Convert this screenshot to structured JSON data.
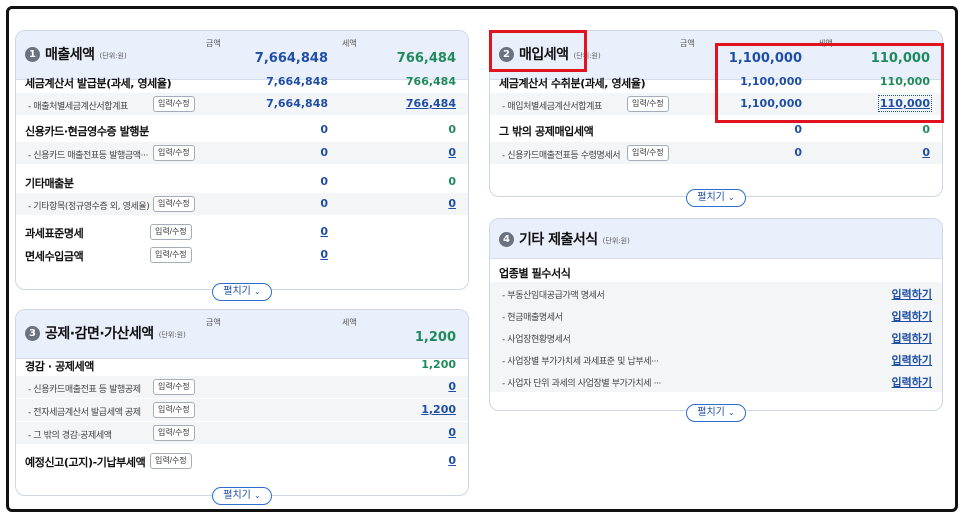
{
  "sales": {
    "badge": "1",
    "title": "매출세액",
    "unit": "(단위:원)",
    "col_amount": "금액",
    "col_tax": "세액",
    "total_amount": "7,664,848",
    "total_tax": "766,484",
    "rows": [
      {
        "label": "세금계산서 발급분(과세, 영세율)",
        "amount": "7,664,848",
        "tax": "766,484"
      },
      {
        "label": "- 매출처별세금계산서합계표",
        "button": "입력/수정",
        "amount": "7,664,848",
        "tax": "766,484"
      },
      {
        "label": "신용카드·현금영수증 발행분",
        "amount": "0",
        "tax": "0"
      },
      {
        "label": "- 신용카드 매출전표등 발행금액···",
        "button": "입력/수정",
        "amount": "0",
        "tax": "0"
      },
      {
        "label": "기타매출분",
        "amount": "0",
        "tax": "0"
      },
      {
        "label": "- 기타항목(정규영수증 외, 영세율)",
        "button": "입력/수정",
        "amount": "0",
        "tax": "0"
      },
      {
        "label": "과세표준명세",
        "button": "입력/수정",
        "amount": "0"
      },
      {
        "label": "면세수입금액",
        "button": "입력/수정",
        "amount": "0"
      }
    ],
    "expand": "펼치기"
  },
  "purchase": {
    "badge": "2",
    "title": "매입세액",
    "unit": "(단위:원)",
    "col_amount": "금액",
    "col_tax": "세액",
    "total_amount": "1,100,000",
    "total_tax": "110,000",
    "rows": [
      {
        "label": "세금계산서 수취분(과세, 영세율)",
        "amount": "1,100,000",
        "tax": "110,000"
      },
      {
        "label": "- 매입처별세금계산서합계표",
        "button": "입력/수정",
        "amount": "1,100,000",
        "tax": "110,000"
      },
      {
        "label": "그 밖의 공제매입세액",
        "amount": "0",
        "tax": "0"
      },
      {
        "label": "- 신용카드매출전표등 수령명세서",
        "button": "입력/수정",
        "amount": "0",
        "tax": "0"
      }
    ],
    "expand": "펼치기"
  },
  "deduction": {
    "badge": "3",
    "title": "공제·감면·가산세액",
    "unit": "(단위:원)",
    "col_amount": "금액",
    "col_tax": "세액",
    "total_tax": "1,200",
    "rows": [
      {
        "label": "경감 · 공제세액",
        "tax": "1,200"
      },
      {
        "label": "- 신용카드매출전표 등 발행공제",
        "button": "입력/수정",
        "tax": "0"
      },
      {
        "label": "- 전자세금계산서 발급세액 공제",
        "button": "입력/수정",
        "tax": "1,200"
      },
      {
        "label": "- 그 밖의 경감·공제세액",
        "button": "입력/수정",
        "tax": "0"
      },
      {
        "label": "예정신고(고지)-기납부세액",
        "button": "입력/수정",
        "tax": "0"
      }
    ],
    "expand": "펼치기"
  },
  "other": {
    "badge": "4",
    "title": "기타 제출서식",
    "unit": "(단위:원)",
    "section_label": "업종별 필수서식",
    "rows": [
      {
        "label": "- 부동산임대공급가액 명세서",
        "action": "입력하기"
      },
      {
        "label": "- 현금매출명세서",
        "action": "입력하기"
      },
      {
        "label": "- 사업장현황명세서",
        "action": "입력하기"
      },
      {
        "label": "- 사업장별 부가가치세 과세표준 및 납부세···",
        "action": "입력하기"
      },
      {
        "label": "- 사업자 단위 과세의 사업장별 부가가치세 ···",
        "action": "입력하기"
      }
    ],
    "expand": "펼치기"
  },
  "colors": {
    "accent_blue": "#1f4fa5",
    "accent_green": "#1f8a5b",
    "highlight_red": "#e0141e"
  },
  "icons": {
    "expand": "chevron-down-icon"
  }
}
